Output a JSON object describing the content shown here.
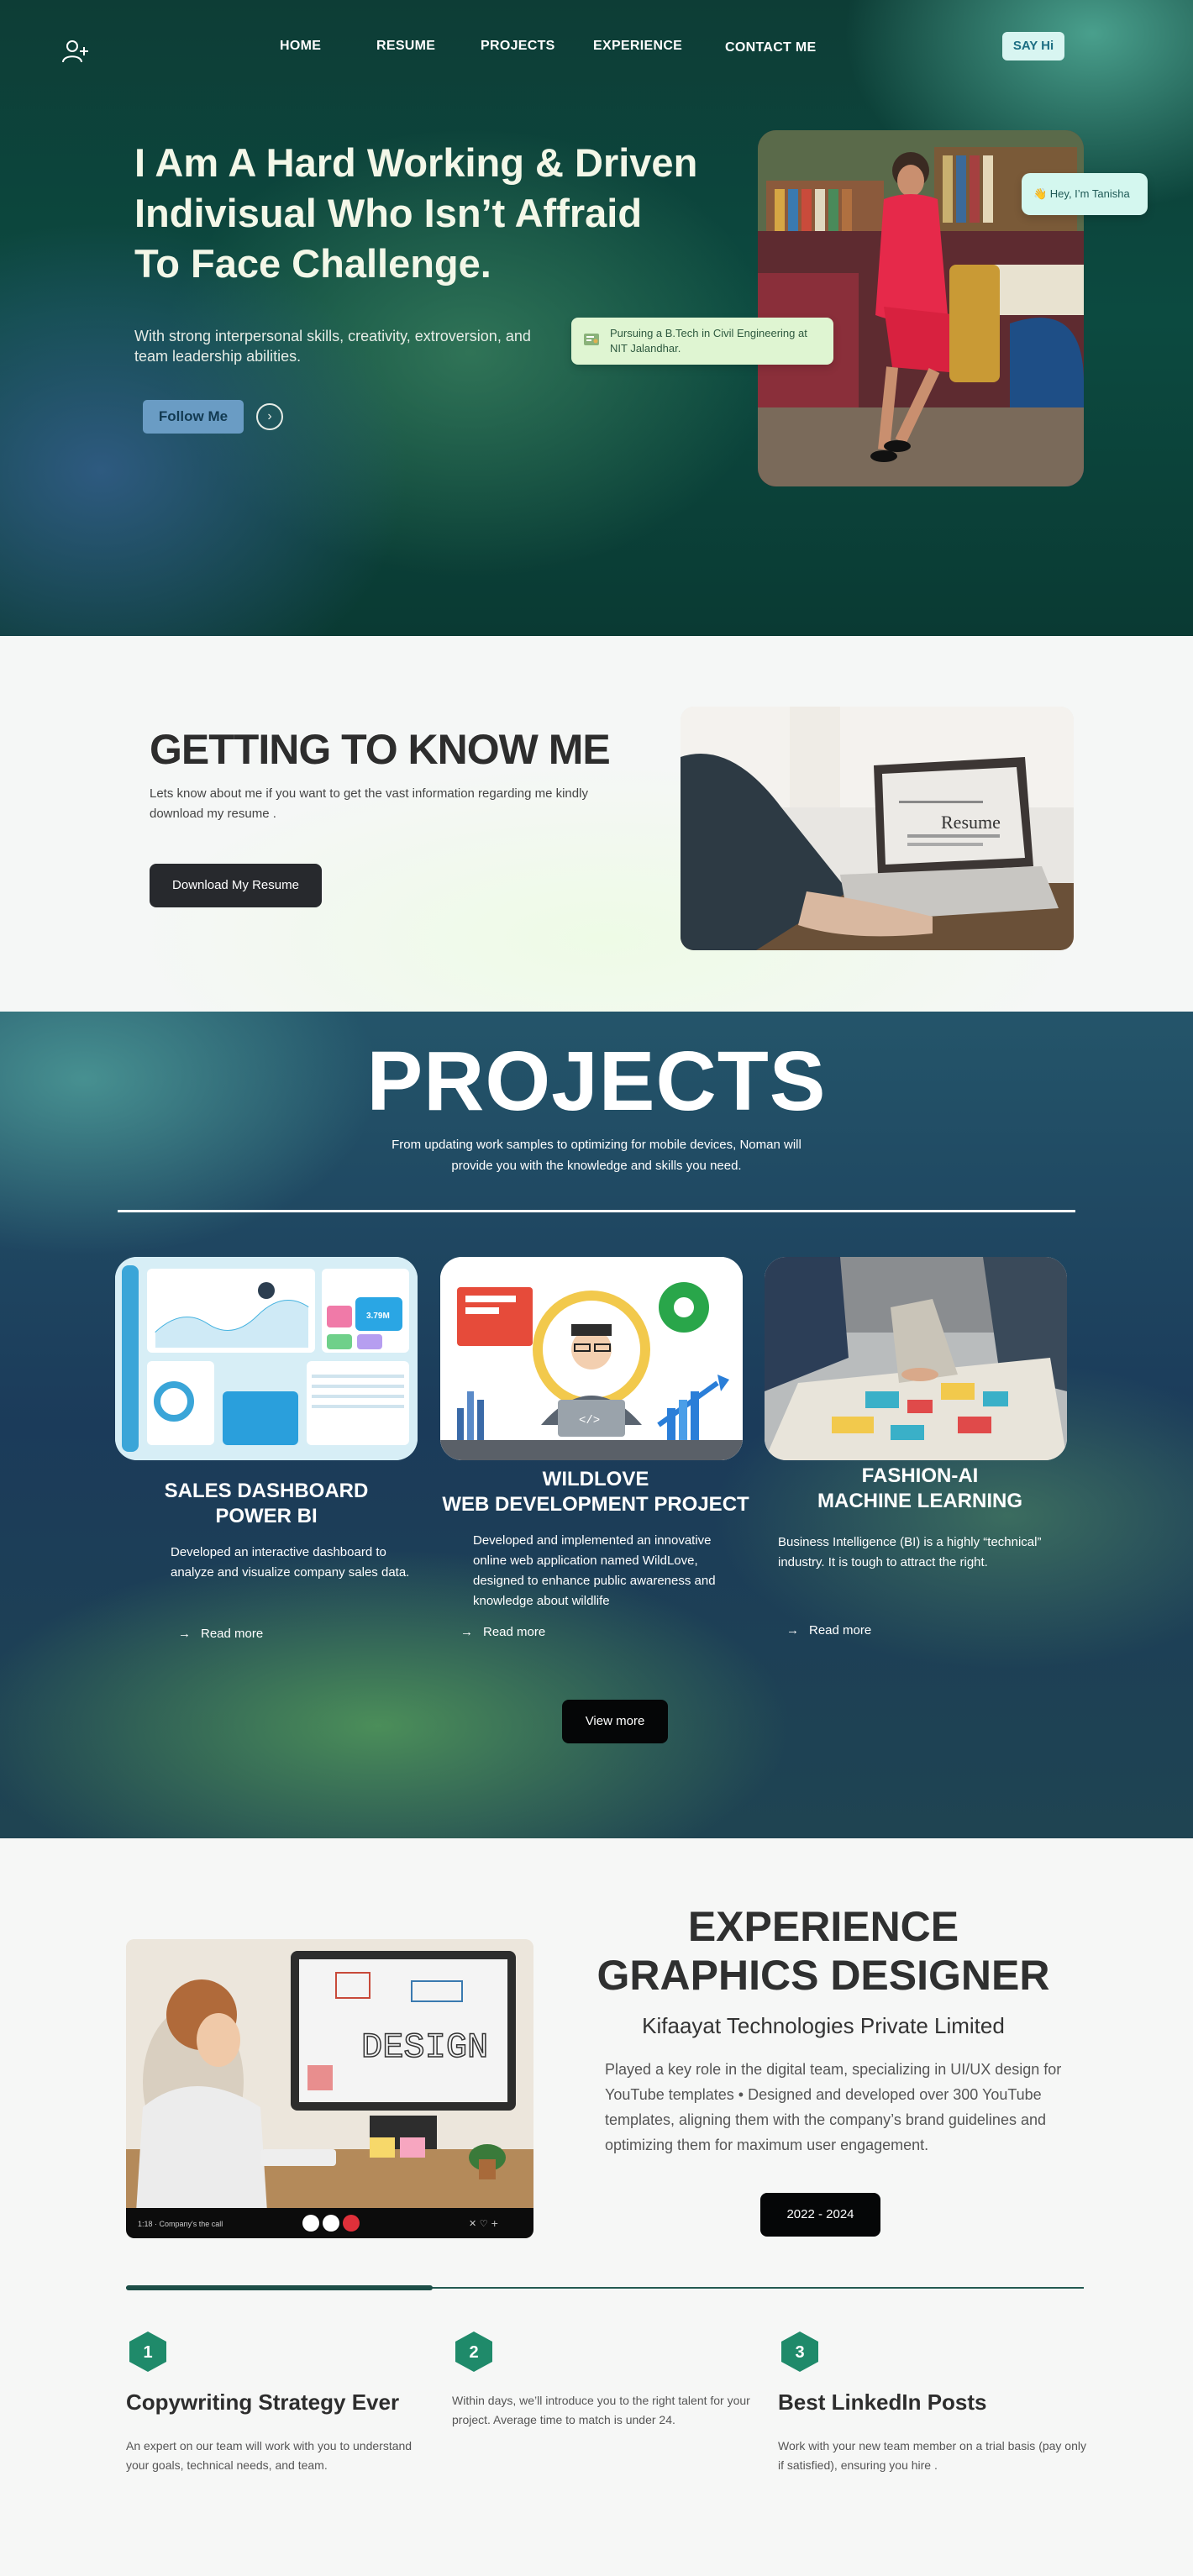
{
  "nav": {
    "home": "HOME",
    "resume": "RESUME",
    "projects": "PROJECTS",
    "experience": "EXPERIENCE",
    "contact": "CONTACT ME",
    "say_hi": "SAY Hi"
  },
  "hero": {
    "title_line1": "I Am A Hard Working & Driven",
    "title_line2": "Indivisual Who Isn’t Affraid",
    "title_line3": "To Face Challenge.",
    "subtitle": "With strong interpersonal skills, creativity, extroversion, and team leadership abilities.",
    "follow_label": "Follow Me",
    "greeting_pill": "👋 Hey, I’m Tanisha",
    "education_pill": "Pursuing a B.Tech in Civil Engineering at NIT Jalandhar."
  },
  "know": {
    "title": "GETTING TO KNOW ME",
    "text": "Lets know about me if you want to get the vast information regarding me kindly download my resume .",
    "button": "Download My Resume",
    "image_caption": "Resume"
  },
  "projects": {
    "title": "PROJECTS",
    "subtitle": "From updating work samples to optimizing for mobile devices, Noman will provide you with the knowledge and skills you need.",
    "cards": [
      {
        "title_line1": "SALES DASHBOARD",
        "title_line2": "POWER BI",
        "desc": "Developed an interactive dashboard to analyze and visualize company sales data.",
        "read_more": "Read more"
      },
      {
        "title_line1": "WILDLOVE",
        "title_line2": "WEB DEVELOPMENT PROJECT",
        "desc": "Developed and implemented an innovative online web application named WildLove, designed to enhance public awareness and knowledge about wildlife",
        "read_more": "Read more"
      },
      {
        "title_line1": "FASHION-AI",
        "title_line2": "MACHINE LEARNING",
        "desc": "Business Intelligence (BI) is a highly “technical” industry. It is tough to attract the right.",
        "read_more": "Read more"
      }
    ],
    "dashboard_value": "3.79M",
    "code_tag": "</>",
    "view_more": "View more"
  },
  "experience": {
    "title_line1": "EXPERIENCE",
    "title_line2": "GRAPHICS DESIGNER",
    "company": "Kifaayat Technologies Private Limited",
    "desc": "Played a key role in the digital team, specializing in UI/UX design for YouTube templates  • Designed and developed over 300 YouTube templates, aligning them with the company’s brand guidelines and optimizing them for maximum user engagement.",
    "dates": "2022 - 2024",
    "screen_word": "DESIGN",
    "video_time": "1:18 · Company's the call",
    "progress_fraction": 0.32,
    "steps": [
      {
        "number": "1",
        "title": "Copywriting Strategy Ever",
        "desc": "An expert on our team will work with you to understand your goals, technical needs, and team."
      },
      {
        "number": "2",
        "title": "",
        "desc": "Within days, we’ll introduce you to the right talent for your project. Average time to match is under 24."
      },
      {
        "number": "3",
        "title": "Best LinkedIn Posts",
        "desc": "Work with your new team member on a trial basis (pay only if satisfied), ensuring you hire ."
      }
    ]
  },
  "colors": {
    "hero_bg": "#0c4a40",
    "accent_teal": "#1d4e47",
    "step_hex": "#1f8a6a",
    "button_dark": "#050607"
  }
}
